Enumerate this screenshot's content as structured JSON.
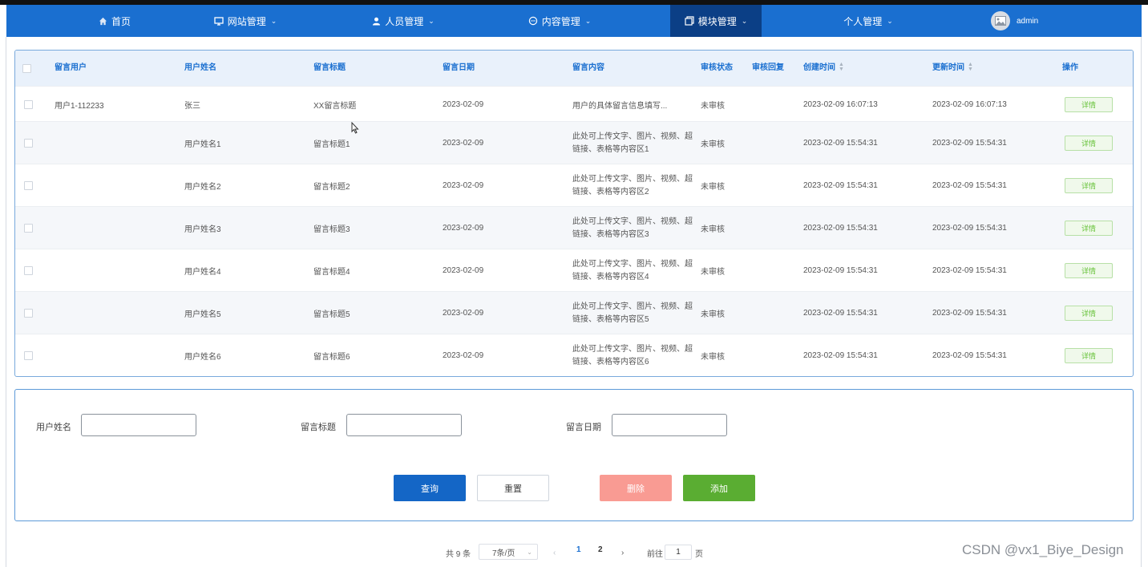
{
  "nav": {
    "items": [
      {
        "label": "首页",
        "icon": "home-icon"
      },
      {
        "label": "网站管理",
        "icon": "monitor-icon"
      },
      {
        "label": "人员管理",
        "icon": "user-icon"
      },
      {
        "label": "内容管理",
        "icon": "chat-icon"
      },
      {
        "label": "模块管理",
        "icon": "module-icon",
        "active": true
      },
      {
        "label": "个人管理",
        "icon": ""
      }
    ],
    "user": "admin"
  },
  "table": {
    "headers": {
      "user": "留言用户",
      "name": "用户姓名",
      "title": "留言标题",
      "date": "留言日期",
      "content": "留言内容",
      "status": "审核状态",
      "reply": "审核回复",
      "created": "创建时间",
      "updated": "更新时间",
      "action": "操作"
    },
    "rows": [
      {
        "user": "用户1-112233",
        "name": "张三",
        "title": "XX留言标题",
        "date": "2023-02-09",
        "content": "用户的具体留言信息填写...",
        "status": "未审核",
        "reply": "",
        "created": "2023-02-09 16:07:13",
        "updated": "2023-02-09 16:07:13",
        "action": "详情"
      },
      {
        "user": "",
        "name": "用户姓名1",
        "title": "留言标题1",
        "date": "2023-02-09",
        "content": "此处可上传文字、图片、视频、超链接、表格等内容区1",
        "status": "未审核",
        "reply": "",
        "created": "2023-02-09 15:54:31",
        "updated": "2023-02-09 15:54:31",
        "action": "详情"
      },
      {
        "user": "",
        "name": "用户姓名2",
        "title": "留言标题2",
        "date": "2023-02-09",
        "content": "此处可上传文字、图片、视频、超链接、表格等内容区2",
        "status": "未审核",
        "reply": "",
        "created": "2023-02-09 15:54:31",
        "updated": "2023-02-09 15:54:31",
        "action": "详情"
      },
      {
        "user": "",
        "name": "用户姓名3",
        "title": "留言标题3",
        "date": "2023-02-09",
        "content": "此处可上传文字、图片、视频、超链接、表格等内容区3",
        "status": "未审核",
        "reply": "",
        "created": "2023-02-09 15:54:31",
        "updated": "2023-02-09 15:54:31",
        "action": "详情"
      },
      {
        "user": "",
        "name": "用户姓名4",
        "title": "留言标题4",
        "date": "2023-02-09",
        "content": "此处可上传文字、图片、视频、超链接、表格等内容区4",
        "status": "未审核",
        "reply": "",
        "created": "2023-02-09 15:54:31",
        "updated": "2023-02-09 15:54:31",
        "action": "详情"
      },
      {
        "user": "",
        "name": "用户姓名5",
        "title": "留言标题5",
        "date": "2023-02-09",
        "content": "此处可上传文字、图片、视频、超链接、表格等内容区5",
        "status": "未审核",
        "reply": "",
        "created": "2023-02-09 15:54:31",
        "updated": "2023-02-09 15:54:31",
        "action": "详情"
      },
      {
        "user": "",
        "name": "用户姓名6",
        "title": "留言标题6",
        "date": "2023-02-09",
        "content": "此处可上传文字、图片、视频、超链接、表格等内容区6",
        "status": "未审核",
        "reply": "",
        "created": "2023-02-09 15:54:31",
        "updated": "2023-02-09 15:54:31",
        "action": "详情"
      }
    ]
  },
  "search": {
    "name_label": "用户姓名",
    "title_label": "留言标题",
    "date_label": "留言日期",
    "name_value": "",
    "title_value": "",
    "date_value": "",
    "query": "查询",
    "reset": "重置",
    "delete": "删除",
    "add": "添加"
  },
  "pagination": {
    "total": "共 9 条",
    "page_size": "7条/页",
    "pages": [
      "1",
      "2"
    ],
    "current": "1",
    "goto": "前往",
    "goto_value": "1",
    "page_unit": "页"
  },
  "watermark": "CSDN @vx1_Biye_Design",
  "colors": {
    "nav": "#1a6fd0",
    "nav_active": "#0b3f86",
    "query": "#1466c6",
    "delete": "#f99b93",
    "add": "#5aad32"
  }
}
